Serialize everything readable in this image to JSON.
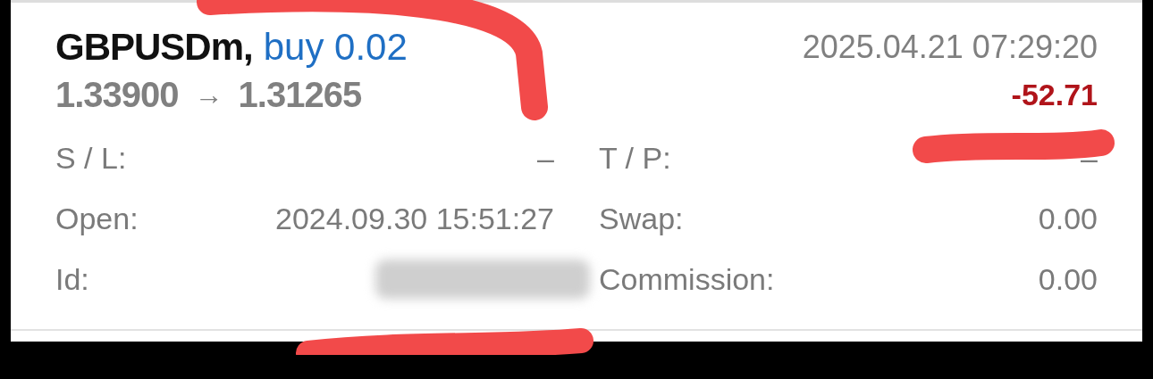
{
  "position": {
    "symbol": "GBPUSDm,",
    "side": "buy 0.02",
    "open_price": "1.33900",
    "arrow": "→",
    "current_price": "1.31265",
    "time": "2025.04.21 07:29:20",
    "profit": "-52.71"
  },
  "details": [
    {
      "label": "S / L:",
      "value": "–",
      "kind": "text"
    },
    {
      "label": "T / P:",
      "value": "–",
      "kind": "text"
    },
    {
      "label": "Open:",
      "value": "2024.09.30 15:51:27",
      "kind": "text"
    },
    {
      "label": "Swap:",
      "value": "0.00",
      "kind": "text"
    },
    {
      "label": "Id:",
      "kind": "redacted"
    },
    {
      "label": "Commission:",
      "value": "0.00",
      "kind": "text"
    }
  ]
}
